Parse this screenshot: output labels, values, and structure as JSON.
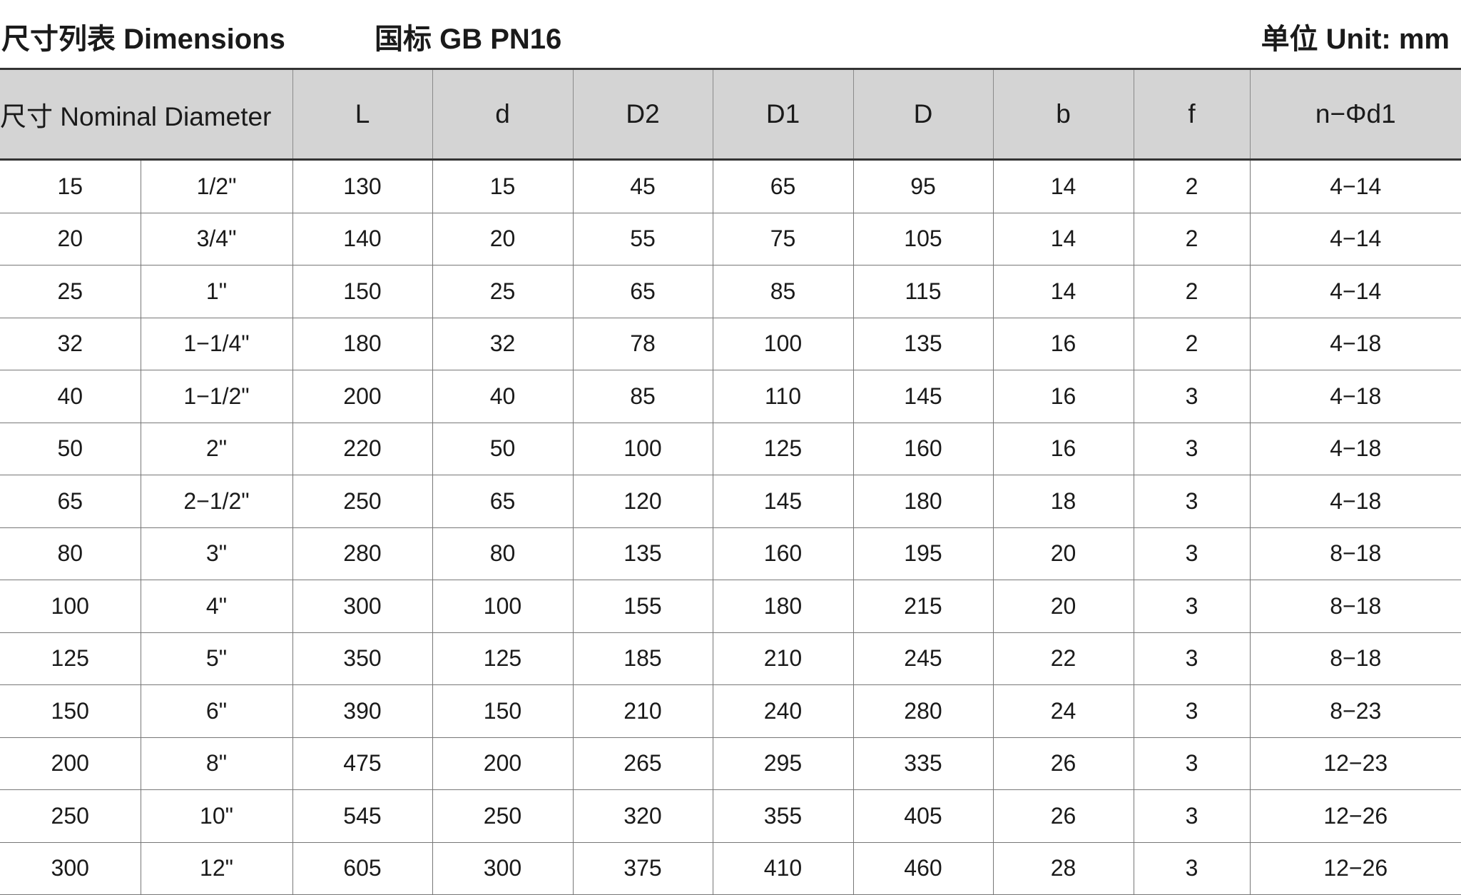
{
  "header": {
    "title": "尺寸列表 Dimensions",
    "standard": "国标 GB PN16",
    "unit": "单位 Unit: mm"
  },
  "table": {
    "columns": [
      "尺寸 Nominal Diameter",
      "L",
      "d",
      "D2",
      "D1",
      "D",
      "b",
      "f",
      "n−Φd1"
    ],
    "rows": [
      [
        "15",
        "1/2\"",
        "130",
        "15",
        "45",
        "65",
        "95",
        "14",
        "2",
        "4−14"
      ],
      [
        "20",
        "3/4\"",
        "140",
        "20",
        "55",
        "75",
        "105",
        "14",
        "2",
        "4−14"
      ],
      [
        "25",
        "1\"",
        "150",
        "25",
        "65",
        "85",
        "115",
        "14",
        "2",
        "4−14"
      ],
      [
        "32",
        "1−1/4\"",
        "180",
        "32",
        "78",
        "100",
        "135",
        "16",
        "2",
        "4−18"
      ],
      [
        "40",
        "1−1/2\"",
        "200",
        "40",
        "85",
        "110",
        "145",
        "16",
        "3",
        "4−18"
      ],
      [
        "50",
        "2\"",
        "220",
        "50",
        "100",
        "125",
        "160",
        "16",
        "3",
        "4−18"
      ],
      [
        "65",
        "2−1/2\"",
        "250",
        "65",
        "120",
        "145",
        "180",
        "18",
        "3",
        "4−18"
      ],
      [
        "80",
        "3\"",
        "280",
        "80",
        "135",
        "160",
        "195",
        "20",
        "3",
        "8−18"
      ],
      [
        "100",
        "4\"",
        "300",
        "100",
        "155",
        "180",
        "215",
        "20",
        "3",
        "8−18"
      ],
      [
        "125",
        "5\"",
        "350",
        "125",
        "185",
        "210",
        "245",
        "22",
        "3",
        "8−18"
      ],
      [
        "150",
        "6\"",
        "390",
        "150",
        "210",
        "240",
        "280",
        "24",
        "3",
        "8−23"
      ],
      [
        "200",
        "8\"",
        "475",
        "200",
        "265",
        "295",
        "335",
        "26",
        "3",
        "12−23"
      ],
      [
        "250",
        "10\"",
        "545",
        "250",
        "320",
        "355",
        "405",
        "26",
        "3",
        "12−26"
      ],
      [
        "300",
        "12\"",
        "605",
        "300",
        "375",
        "410",
        "460",
        "28",
        "3",
        "12−26"
      ]
    ]
  }
}
